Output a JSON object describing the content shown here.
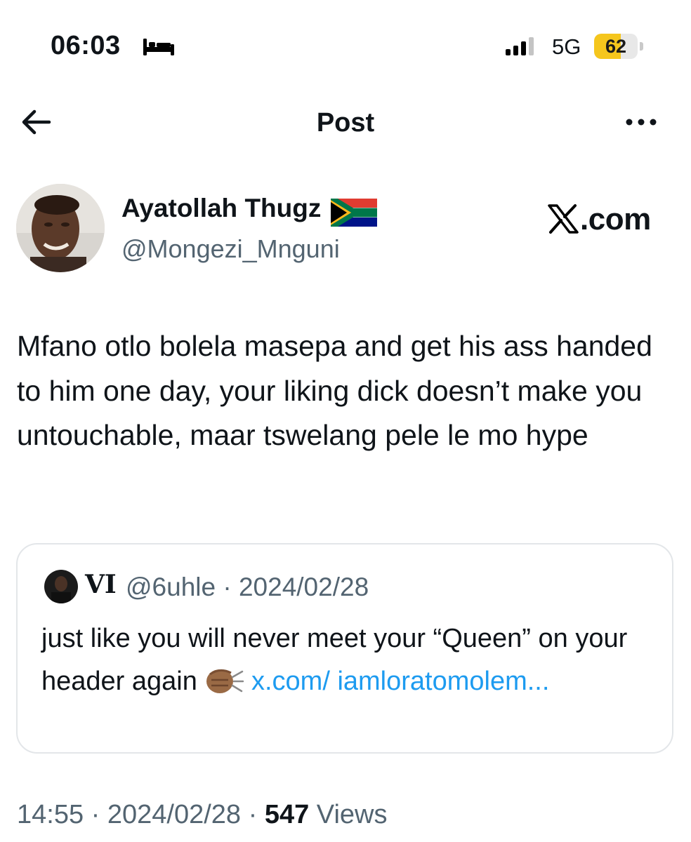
{
  "status_bar": {
    "time": "06:03",
    "network": "5G",
    "battery": "62",
    "battery_level": 0.62,
    "battery_color": "#f5c61d"
  },
  "nav": {
    "title": "Post",
    "back_icon": "arrow-left-icon",
    "more_icon": "ellipsis-icon"
  },
  "author": {
    "name": "Ayatollah Thugz",
    "name_emoji": "south-africa-flag",
    "handle": "@Mongezi_Mnguni",
    "watermark": "X.com"
  },
  "post": {
    "text": "Mfano otlo bolela masepa and get his ass handed to him one day, your liking dick doesn’t make you untouchable, maar tswelang pele le mo hype"
  },
  "quote": {
    "name": "VI",
    "handle_date": "@6uhle · 2024/02/28",
    "text": "just like you will never meet your “Queen” on your header again",
    "emoji": "fist-punch-emoji",
    "link": "x.com/ iamloratomolem...",
    "link_color": "#1d9bf0"
  },
  "meta": {
    "time_date": "14:55 · 2024/02/28 · ",
    "views_count": "547",
    "views_label": " Views"
  }
}
